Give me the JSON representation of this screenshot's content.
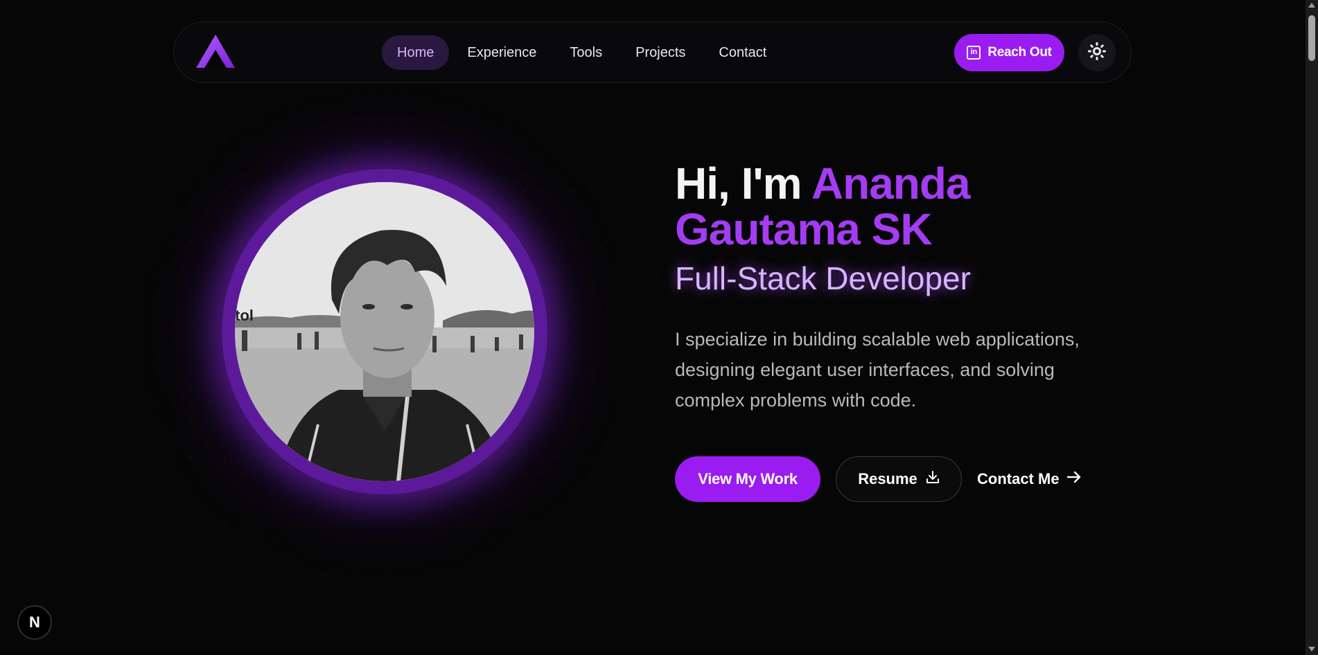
{
  "nav": {
    "logo_alt": "A",
    "links": [
      {
        "label": "Home",
        "active": true
      },
      {
        "label": "Experience",
        "active": false
      },
      {
        "label": "Tools",
        "active": false
      },
      {
        "label": "Projects",
        "active": false
      },
      {
        "label": "Contact",
        "active": false
      }
    ],
    "reach_out_label": "Reach Out",
    "reach_out_icon": "linkedin-icon",
    "theme_toggle_icon": "sun-icon"
  },
  "hero": {
    "greeting_prefix": "Hi, I'm",
    "name_first": "Ananda",
    "name_rest": "Gautama SK",
    "role": "Full-Stack Developer",
    "intro": "I specialize in building scalable web applications, designing elegant user interfaces, and solving complex problems with code.",
    "photo_icon": "profile-photo",
    "buttons": {
      "view_work": "View My Work",
      "resume": "Resume",
      "resume_icon": "download-icon",
      "contact": "Contact Me",
      "contact_icon": "arrow-right-icon"
    }
  },
  "badge": {
    "label": "N"
  },
  "colors": {
    "accent": "#9a1cf0",
    "accent_text": "#a33cf2",
    "role_text": "#d7b3ff",
    "background": "#060606"
  }
}
